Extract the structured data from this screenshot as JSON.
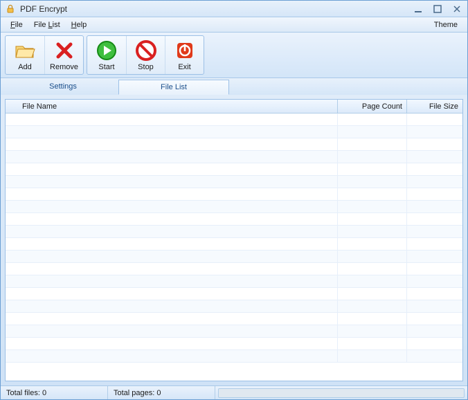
{
  "window": {
    "title": "PDF Encrypt"
  },
  "menu": {
    "file": "File",
    "filelist": "File List",
    "help": "Help",
    "theme": "Theme"
  },
  "toolbar": {
    "add": "Add",
    "remove": "Remove",
    "start": "Start",
    "stop": "Stop",
    "exit": "Exit"
  },
  "tabs": {
    "settings": "Settings",
    "filelist": "File List"
  },
  "columns": {
    "filename": "File Name",
    "pagecount": "Page Count",
    "filesize": "File Size"
  },
  "status": {
    "totalfiles": "Total files: 0",
    "totalpages": "Total pages: 0"
  },
  "icons": {
    "app": "lock-icon",
    "add": "folder-open-icon",
    "remove": "x-icon",
    "start": "play-icon",
    "stop": "no-entry-icon",
    "exit": "power-icon"
  },
  "colors": {
    "accent": "#6b9fd4",
    "text": "#1a1a1a",
    "tab_text": "#1a4e8a"
  }
}
